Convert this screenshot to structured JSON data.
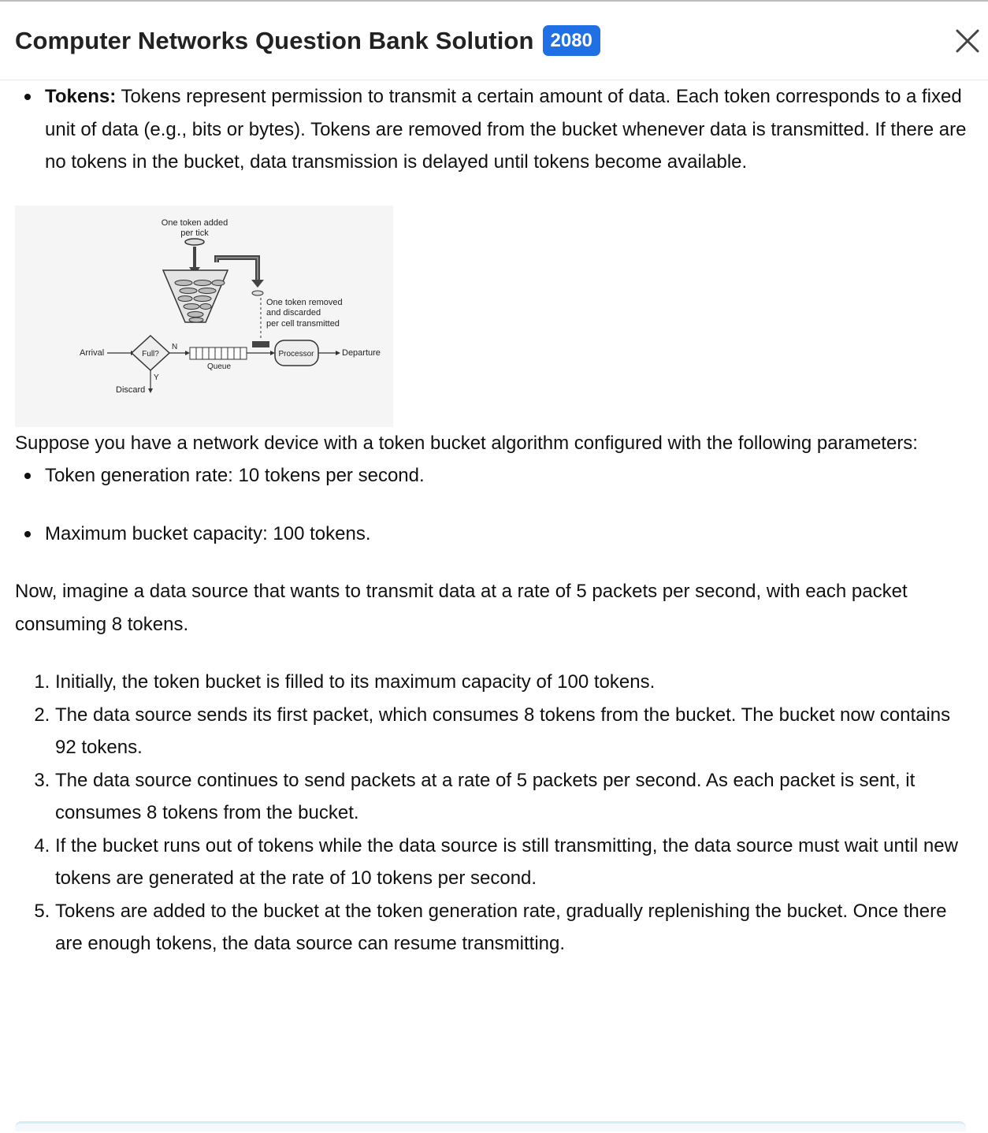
{
  "header": {
    "title": "Computer Networks Question Bank Solution",
    "badge": "2080"
  },
  "tokens_bullet": {
    "term": "Tokens:",
    "text": " Tokens represent permission to transmit a certain amount of data. Each token corresponds to a fixed unit of data (e.g., bits or bytes). Tokens are removed from the bucket whenever data is transmitted. If there are no tokens in the bucket, data transmission is delayed until tokens become available."
  },
  "diagram": {
    "added_line1": "One token added",
    "added_line2": "per tick",
    "removed_line1": "One token removed",
    "removed_line2": "and discarded",
    "removed_line3": "per cell transmitted",
    "arrival": "Arrival",
    "full": "Full?",
    "n": "N",
    "y": "Y",
    "discard": "Discard",
    "queue": "Queue",
    "processor": "Processor",
    "departure": "Departure"
  },
  "intro": "Suppose you have a network device with a token bucket algorithm configured with the following parameters:",
  "params": [
    "Token generation rate: 10 tokens per second.",
    "Maximum bucket capacity: 100 tokens."
  ],
  "scenario": "Now, imagine a data source that wants to transmit data at a rate of 5 packets per second, with each packet consuming 8 tokens.",
  "steps": [
    "Initially, the token bucket is filled to its maximum capacity of 100 tokens.",
    "The data source sends its first packet, which consumes 8 tokens from the bucket. The bucket now contains 92 tokens.",
    "The data source continues to send packets at a rate of 5 packets per second. As each packet is sent, it consumes 8 tokens from the bucket.",
    "If the bucket runs out of tokens while the data source is still transmitting, the data source must wait until new tokens are generated at the rate of 10 tokens per second.",
    "Tokens are added to the bucket at the token generation rate, gradually replenishing the bucket. Once there are enough tokens, the data source can resume transmitting."
  ]
}
